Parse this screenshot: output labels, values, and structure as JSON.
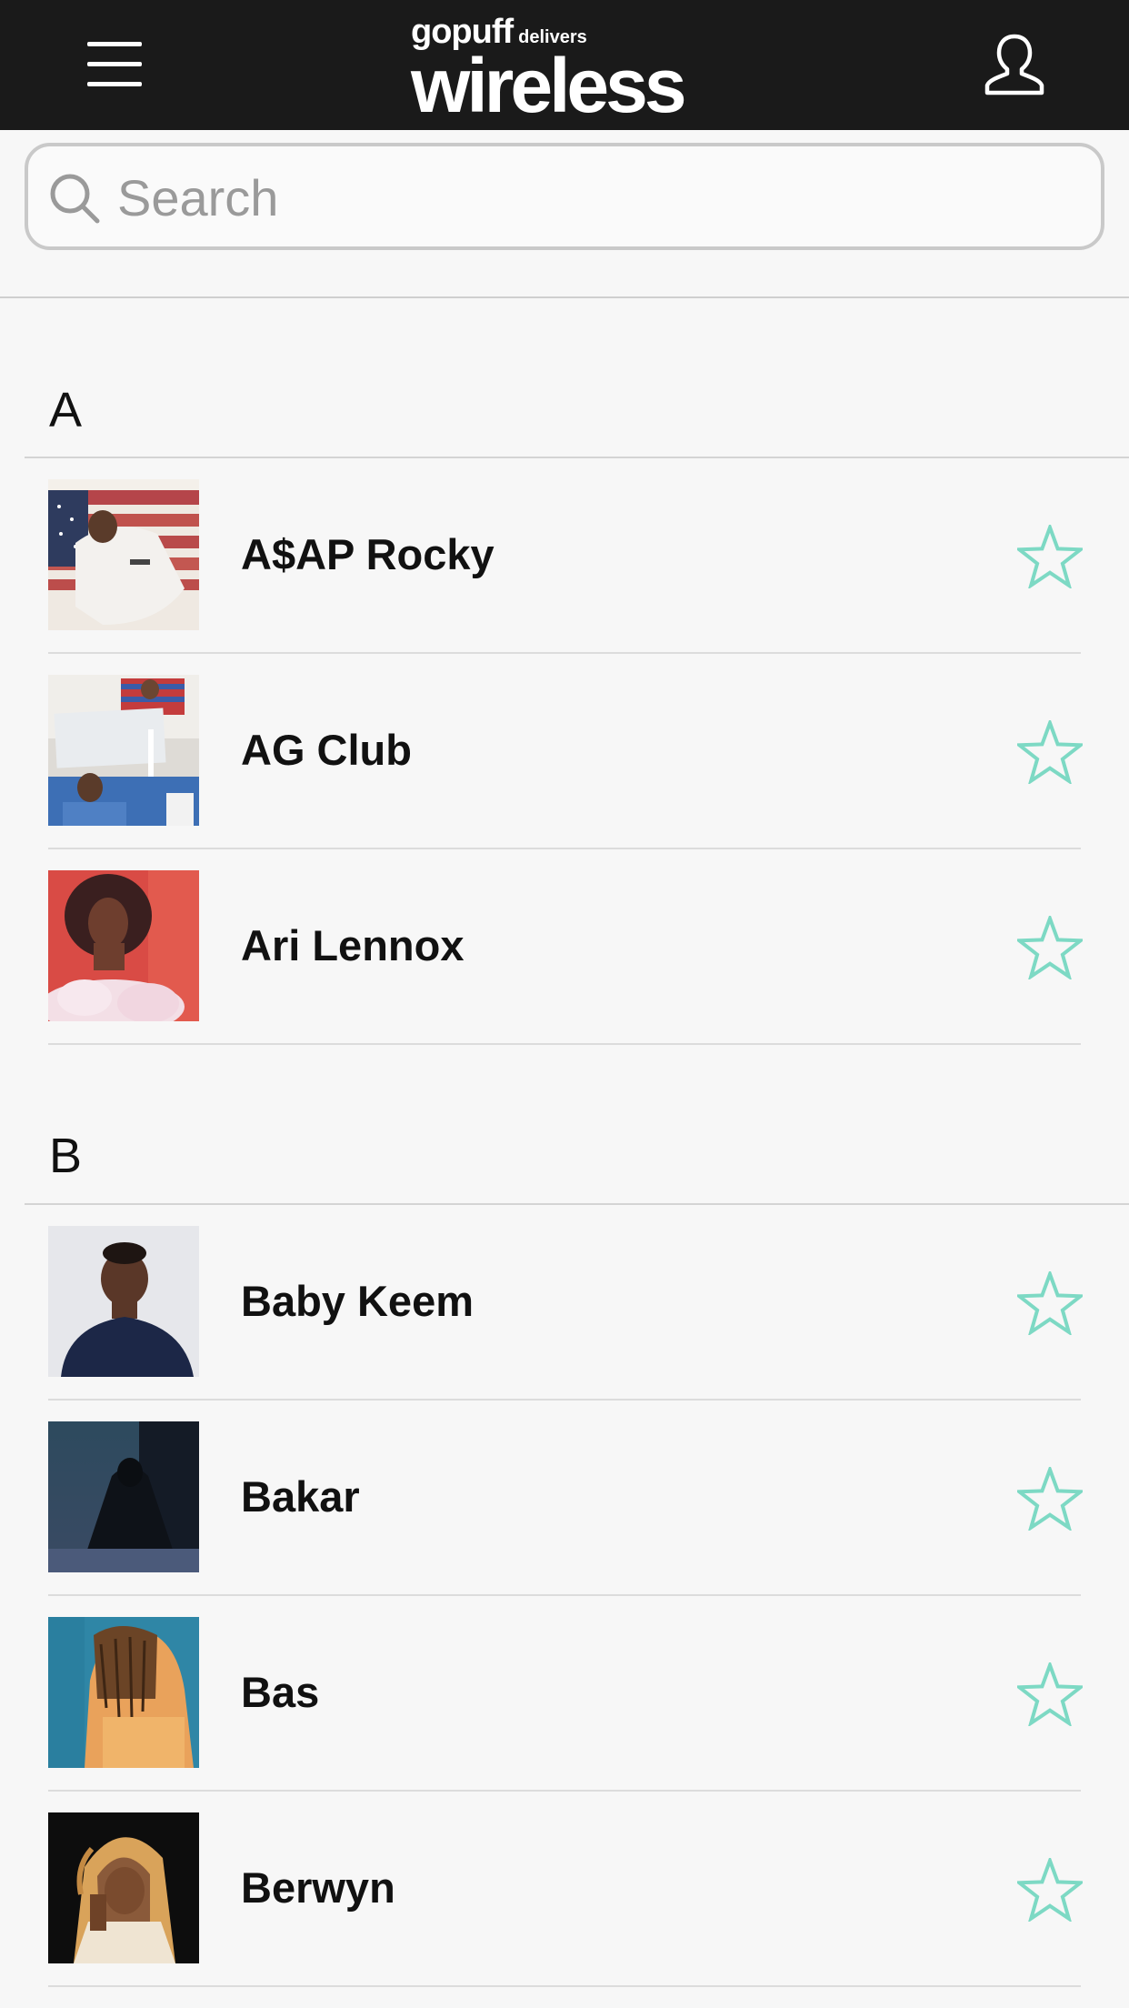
{
  "header": {
    "brand": "gopuff",
    "tagline": "delivers",
    "event": "wireless",
    "menu_icon": "hamburger-menu-icon",
    "profile_icon": "user-profile-icon"
  },
  "search": {
    "placeholder": "Search",
    "icon": "search-icon"
  },
  "colors": {
    "topbar": "#1a1a1a",
    "background": "#f7f7f7",
    "star": "#7dd9c4"
  },
  "sections": [
    {
      "letter": "A",
      "artists": [
        {
          "name": "A$AP Rocky",
          "favorite_icon": "star-outline-icon"
        },
        {
          "name": "AG Club",
          "favorite_icon": "star-outline-icon"
        },
        {
          "name": "Ari Lennox",
          "favorite_icon": "star-outline-icon"
        }
      ]
    },
    {
      "letter": "B",
      "artists": [
        {
          "name": "Baby Keem",
          "favorite_icon": "star-outline-icon"
        },
        {
          "name": "Bakar",
          "favorite_icon": "star-outline-icon"
        },
        {
          "name": "Bas",
          "favorite_icon": "star-outline-icon"
        },
        {
          "name": "Berwyn",
          "favorite_icon": "star-outline-icon"
        }
      ]
    }
  ]
}
